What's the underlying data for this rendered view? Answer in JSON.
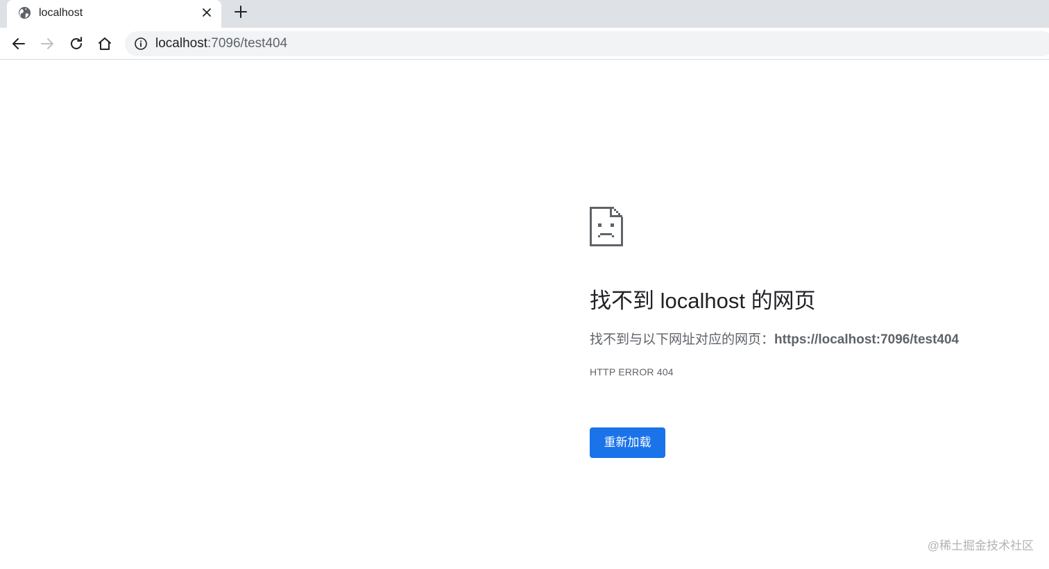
{
  "tab": {
    "title": "localhost",
    "favicon": "globe-icon",
    "close_icon": "close-icon"
  },
  "new_tab_icon": "plus-icon",
  "toolbar": {
    "back_icon": "back-arrow-icon",
    "forward_icon": "forward-arrow-icon",
    "reload_icon": "reload-icon",
    "home_icon": "home-icon"
  },
  "omnibox": {
    "info_icon": "info-icon",
    "host": "localhost",
    "path": ":7096/test404"
  },
  "error_page": {
    "icon": "sad-page-icon",
    "heading": "找不到 localhost 的网页",
    "description_prefix": "找不到与以下网址对应的网页：",
    "description_url": "https://localhost:7096/test404",
    "error_code": "HTTP ERROR 404",
    "reload_button": "重新加载"
  },
  "watermark": "@稀土掘金技术社区",
  "colors": {
    "tabstrip_bg": "#dee1e6",
    "omnibox_bg": "#f1f3f4",
    "button_blue": "#1a73e8",
    "text_primary": "#202124",
    "text_secondary": "#5f6368"
  }
}
